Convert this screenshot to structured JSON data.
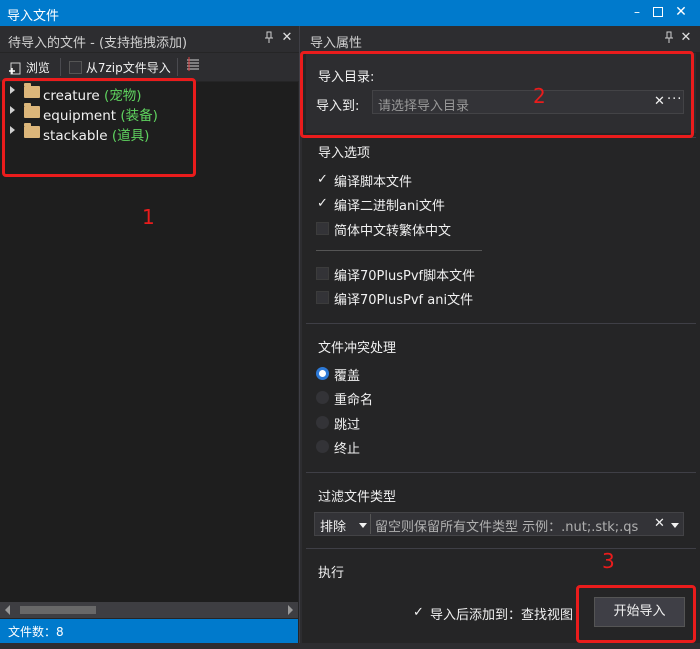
{
  "window": {
    "title": "导入文件"
  },
  "left_panel": {
    "title": "待导入的文件 - (支持拖拽添加)",
    "toolbar": {
      "browse_label": "浏览",
      "from_7zip_label": "从7zip文件导入"
    },
    "tree": [
      {
        "name": "creature",
        "tag": "(宠物)"
      },
      {
        "name": "equipment",
        "tag": "(装备)"
      },
      {
        "name": "stackable",
        "tag": "(道具)"
      }
    ],
    "status": "文件数：8"
  },
  "right_panel": {
    "title": "导入属性",
    "import_dir": {
      "group_label": "导入目录:",
      "field_label": "导入到:",
      "placeholder": "请选择导入目录"
    },
    "import_options": {
      "group_label": "导入选项",
      "items": [
        {
          "label": "编译脚本文件",
          "checked": true
        },
        {
          "label": "编译二进制ani文件",
          "checked": true
        },
        {
          "label": "简体中文转繁体中文",
          "checked": false
        },
        {
          "label": "编译70PlusPvf脚本文件",
          "checked": false
        },
        {
          "label": "编译70PlusPvf ani文件",
          "checked": false
        }
      ]
    },
    "conflict": {
      "group_label": "文件冲突处理",
      "options": [
        {
          "label": "覆盖",
          "selected": true
        },
        {
          "label": "重命名",
          "selected": false
        },
        {
          "label": "跳过",
          "selected": false
        },
        {
          "label": "终止",
          "selected": false
        }
      ]
    },
    "filter": {
      "group_label": "过滤文件类型",
      "mode": "排除",
      "hint": "留空则保留所有文件类型 示例：.nut;.stk;.qs"
    },
    "execute": {
      "group_label": "执行",
      "after_import_label": "导入后添加到：查找视图",
      "after_import_checked": true,
      "start_button": "开始导入"
    }
  },
  "annotations": [
    "1",
    "2",
    "3"
  ],
  "colors": {
    "accent": "#007acc",
    "highlight": "#ea1c1c",
    "tag_green": "#5fd35f"
  }
}
